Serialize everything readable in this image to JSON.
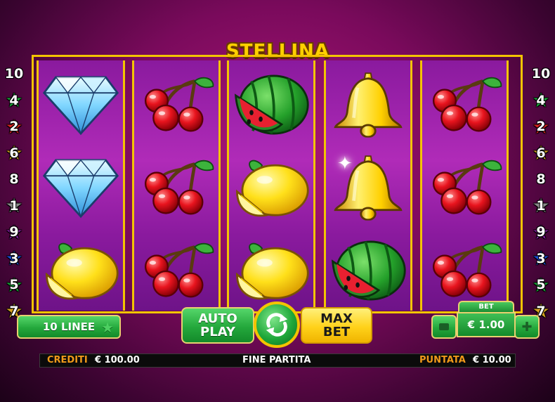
{
  "game": {
    "title": "STELLINA"
  },
  "paylines": {
    "left": [
      "10",
      "4",
      "2",
      "6",
      "8",
      "1",
      "9",
      "3",
      "5",
      "7"
    ],
    "right": [
      "10",
      "4",
      "2",
      "6",
      "8",
      "1",
      "9",
      "3",
      "5",
      "7"
    ]
  },
  "reels": [
    [
      "diamond",
      "diamond",
      "lemon"
    ],
    [
      "cherries",
      "cherries",
      "cherries"
    ],
    [
      "watermelon",
      "lemon",
      "lemon"
    ],
    [
      "bell",
      "bell",
      "watermelon"
    ],
    [
      "cherries",
      "cherries",
      "cherries"
    ]
  ],
  "controls": {
    "lines_label": "10 LINEE",
    "autoplay_line1": "AUTO",
    "autoplay_line2": "PLAY",
    "maxbet_line1": "MAX",
    "maxbet_line2": "BET",
    "bet_caption": "BET",
    "bet_value": "€ 1.00"
  },
  "status_bar": {
    "credits_label": "CREDITI",
    "credits_value": "€ 100.00",
    "message": "FINE PARTITA",
    "stake_label": "PUNTATA",
    "stake_value": "€ 10.00"
  },
  "colors": {
    "frame": "#f3c400",
    "reel_bg": "#9b22ab",
    "button_green": "#24a83c",
    "button_yellow": "#ffd21a",
    "label_orange": "#f09a1a"
  }
}
